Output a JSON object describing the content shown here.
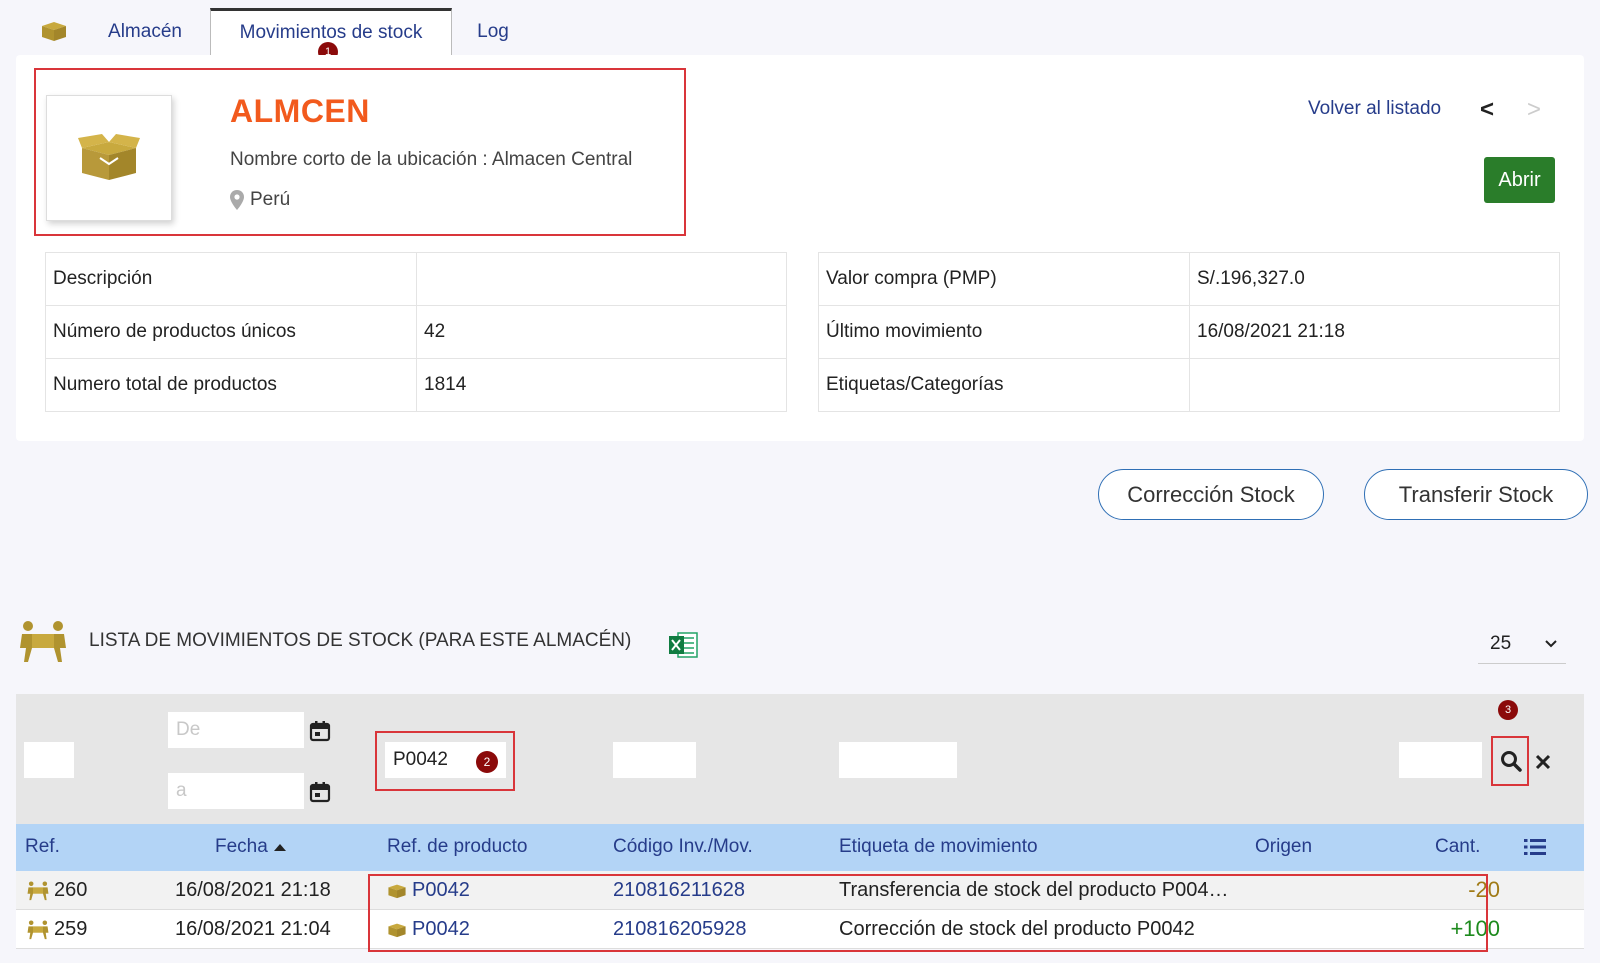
{
  "tabs": [
    {
      "label": "Almacén",
      "icon": "box-icon"
    },
    {
      "label": "Movimientos de stock",
      "active": true
    },
    {
      "label": "Log"
    }
  ],
  "markers": [
    "1",
    "2",
    "3"
  ],
  "header": {
    "title": "ALMCEN",
    "short_name_line": "Nombre corto de la ubicación : Almacen Central",
    "country": "Perú",
    "back_link": "Volver al listado",
    "prev_icon": "<",
    "next_icon": ">",
    "open_button": "Abrir"
  },
  "info_left": [
    {
      "label": "Descripción",
      "value": ""
    },
    {
      "label": "Número de productos únicos",
      "value": "42"
    },
    {
      "label": "Numero total de productos",
      "value": "1814"
    }
  ],
  "info_right": [
    {
      "label": "Valor compra (PMP)",
      "value": "S/.196,327.0"
    },
    {
      "label": "Último movimiento",
      "value": "16/08/2021 21:18"
    },
    {
      "label": "Etiquetas/Categorías",
      "value": ""
    }
  ],
  "actions": {
    "correction": "Corrección Stock",
    "transfer": "Transferir Stock"
  },
  "list": {
    "title": "LISTA DE MOVIMIENTOS DE STOCK (PARA ESTE ALMACÉN)",
    "page_size": "25"
  },
  "filters": {
    "date_from_placeholder": "De",
    "date_to_placeholder": "a",
    "product_ref_value": "P0042"
  },
  "columns": {
    "ref": "Ref.",
    "date": "Fecha",
    "product_ref": "Ref. de producto",
    "code": "Código Inv./Mov.",
    "label": "Etiqueta de movimiento",
    "origin": "Origen",
    "qty": "Cant."
  },
  "rows": [
    {
      "ref": "260",
      "date": "16/08/2021 21:18",
      "product": "P0042",
      "code": "210816211628",
      "label": "Transferencia de stock del producto P004…",
      "origin": "",
      "qty": "-20"
    },
    {
      "ref": "259",
      "date": "16/08/2021 21:04",
      "product": "P0042",
      "code": "210816205928",
      "label": "Corrección de stock del producto P0042",
      "origin": "",
      "qty": "+100"
    }
  ],
  "colors": {
    "accent_title": "#f25a1d",
    "link": "#263c8a",
    "open_button": "#2a7d2a",
    "highlight": "#d9353a",
    "qty_negative": "#a07a16",
    "qty_positive": "#1d8a1d"
  }
}
